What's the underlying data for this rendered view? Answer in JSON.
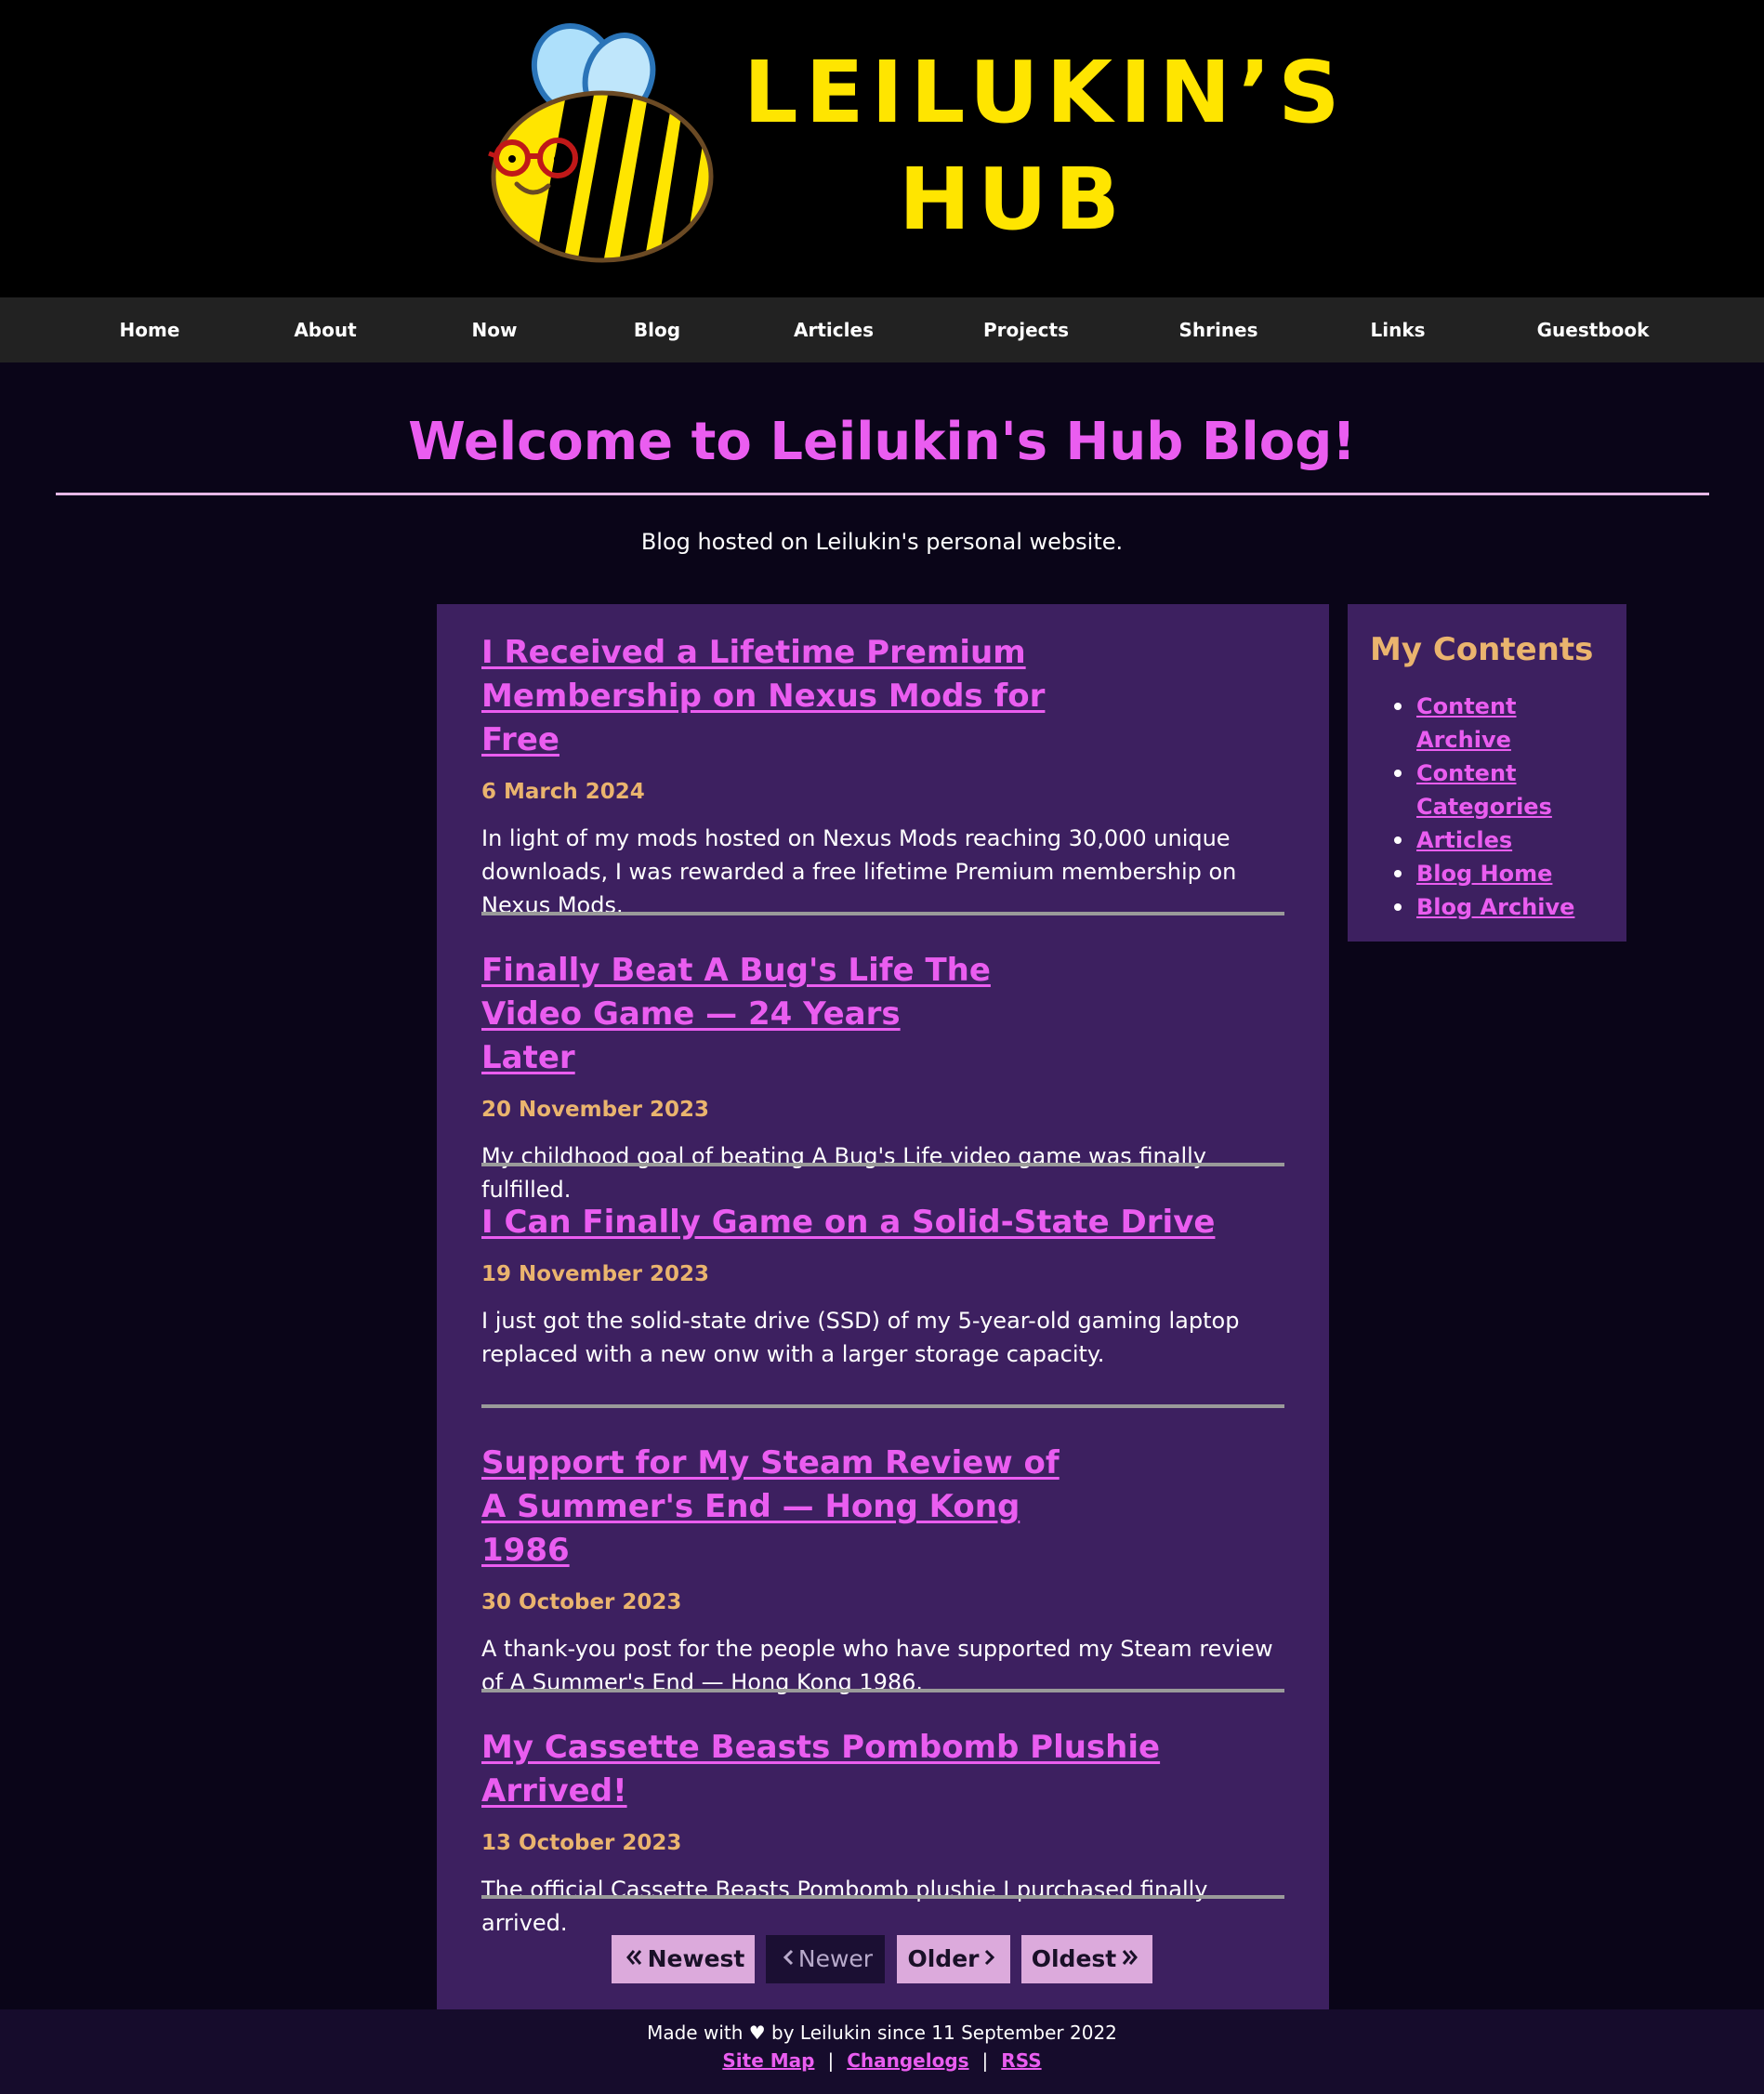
{
  "header": {
    "site_title_line1": "LEILUKIN’S",
    "site_title_line2": "HUB",
    "logo_icon": "bee-with-glasses-icon",
    "title_color": "#ffe500"
  },
  "nav": {
    "items": [
      {
        "label": "Home"
      },
      {
        "label": "About"
      },
      {
        "label": "Now"
      },
      {
        "label": "Blog"
      },
      {
        "label": "Articles"
      },
      {
        "label": "Projects"
      },
      {
        "label": "Shrines"
      },
      {
        "label": "Links"
      },
      {
        "label": "Guestbook"
      }
    ]
  },
  "page": {
    "title": "Welcome to Leilukin's Hub Blog!",
    "subtitle": "Blog hosted on Leilukin's personal website."
  },
  "posts": [
    {
      "title": "I Received a Lifetime Premium Membership on Nexus Mods for Free",
      "date": "6 March 2024",
      "excerpt": "In light of my mods hosted on Nexus Mods reaching 30,000 unique downloads, I was rewarded a free lifetime Premium membership on Nexus Mods."
    },
    {
      "title": "Finally Beat A Bug's Life The Video Game — 24 Years Later",
      "date": "20 November 2023",
      "excerpt": "My childhood goal of beating A Bug's Life video game was finally fulfilled."
    },
    {
      "title": "I Can Finally Game on a Solid-State Drive",
      "date": "19 November 2023",
      "excerpt": "I just got the solid-state drive (SSD) of my 5-year-old gaming laptop replaced with a new onw with a larger storage capacity."
    },
    {
      "title": "Support for My Steam Review of A Summer's End — Hong Kong 1986",
      "date": "30 October 2023",
      "excerpt": "A thank-you post for the people who have supported my Steam review of A Summer's End — Hong Kong 1986."
    },
    {
      "title": "My Cassette Beasts Pombomb Plushie Arrived!",
      "date": "13 October 2023",
      "excerpt": "The official Cassette Beasts Pombomb plushie I purchased finally arrived."
    }
  ],
  "pagination": {
    "newest_label": "Newest",
    "newer_label": "Newer",
    "older_label": "Older",
    "oldest_label": "Oldest",
    "newest_icon": "double-chevron-left-icon",
    "newer_icon": "chevron-left-icon",
    "older_icon": "chevron-right-icon",
    "oldest_icon": "double-chevron-right-icon"
  },
  "sidebar": {
    "title": "My Contents",
    "links": [
      {
        "label": "Content Archive"
      },
      {
        "label": "Content Categories"
      },
      {
        "label": "Articles"
      },
      {
        "label": "Blog Home"
      },
      {
        "label": "Blog Archive"
      }
    ]
  },
  "footer": {
    "credit": "Made with ♥ by Leilukin since 11 September 2022",
    "links": [
      {
        "label": "Site Map"
      },
      {
        "label": "Changelogs"
      },
      {
        "label": "RSS"
      }
    ],
    "separator": "|"
  },
  "colors": {
    "accent_pink": "#ea5df0",
    "date_gold": "#eab46e",
    "panel_purple": "#3d2060",
    "page_background": "#0a0518"
  }
}
